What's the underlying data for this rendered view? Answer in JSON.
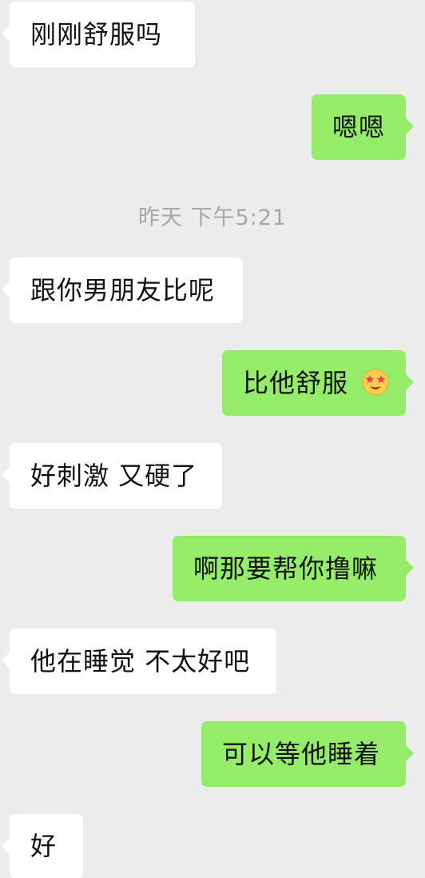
{
  "chat": {
    "timestamp": "昨天 下午5:21",
    "messages": [
      {
        "side": "in",
        "text": "刚刚舒服吗"
      },
      {
        "side": "out",
        "text": "嗯嗯"
      },
      {
        "side": "in",
        "text": "跟你男朋友比呢"
      },
      {
        "side": "out",
        "text": "比他舒服",
        "emoji": "star-struck-emoji"
      },
      {
        "side": "in",
        "text": "好刺激 又硬了"
      },
      {
        "side": "out",
        "text": "啊那要帮你撸嘛"
      },
      {
        "side": "in",
        "text": "他在睡觉 不太好吧"
      },
      {
        "side": "out",
        "text": "可以等他睡着"
      },
      {
        "side": "in",
        "text": "好"
      }
    ]
  },
  "colors": {
    "background": "#ececec",
    "incoming_bubble": "#ffffff",
    "outgoing_bubble": "#95ec69",
    "timestamp_text": "#a6a6a6"
  }
}
